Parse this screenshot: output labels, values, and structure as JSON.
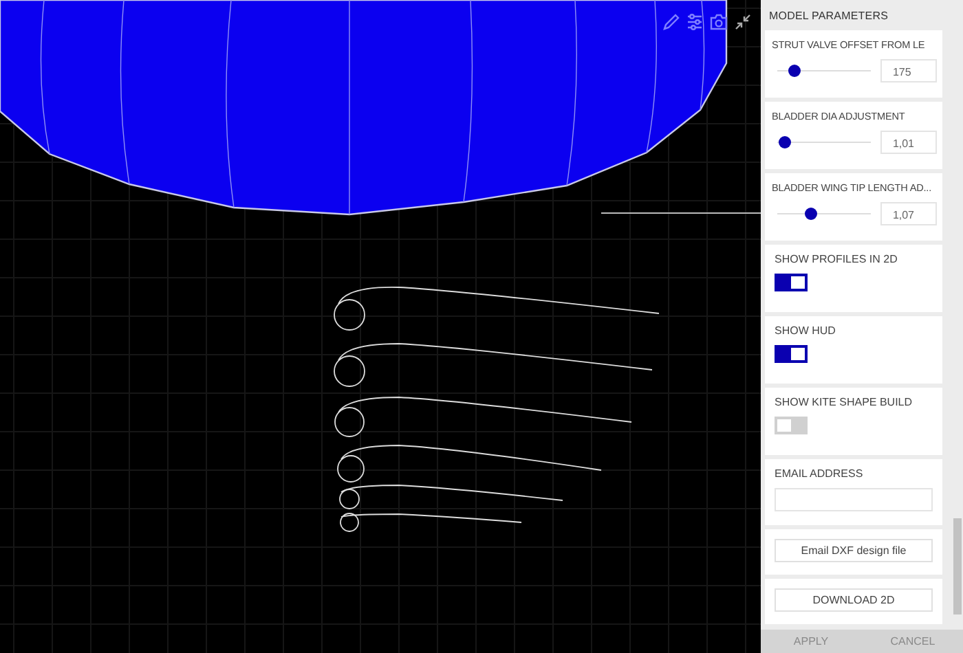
{
  "panel": {
    "title": "MODEL PARAMETERS",
    "params": [
      {
        "kind": "slider",
        "label": "STRUT VALVE OFFSET FROM LE",
        "level": 0.18,
        "value": "175"
      },
      {
        "kind": "slider",
        "label": "BLADDER DIA ADJUSTMENT",
        "level": 0.07,
        "value": "1,01"
      },
      {
        "kind": "slider",
        "label": "BLADDER WING TIP LENGTH AD...",
        "level": 0.36,
        "value": "1,07"
      },
      {
        "kind": "toggle",
        "label": "SHOW PROFILES IN 2D",
        "on": true
      },
      {
        "kind": "toggle",
        "label": "SHOW HUD",
        "on": true
      },
      {
        "kind": "toggle",
        "label": "SHOW KITE SHAPE BUILD",
        "on": false
      },
      {
        "kind": "field",
        "label": "EMAIL ADDRESS"
      },
      {
        "kind": "button",
        "label": "Email DXF design file"
      },
      {
        "kind": "button",
        "label": "DOWNLOAD 2D"
      }
    ]
  },
  "footer": {
    "buttons": [
      {
        "label": "APPLY",
        "disabled": true
      },
      {
        "label": "CANCEL",
        "disabled": true
      }
    ]
  }
}
